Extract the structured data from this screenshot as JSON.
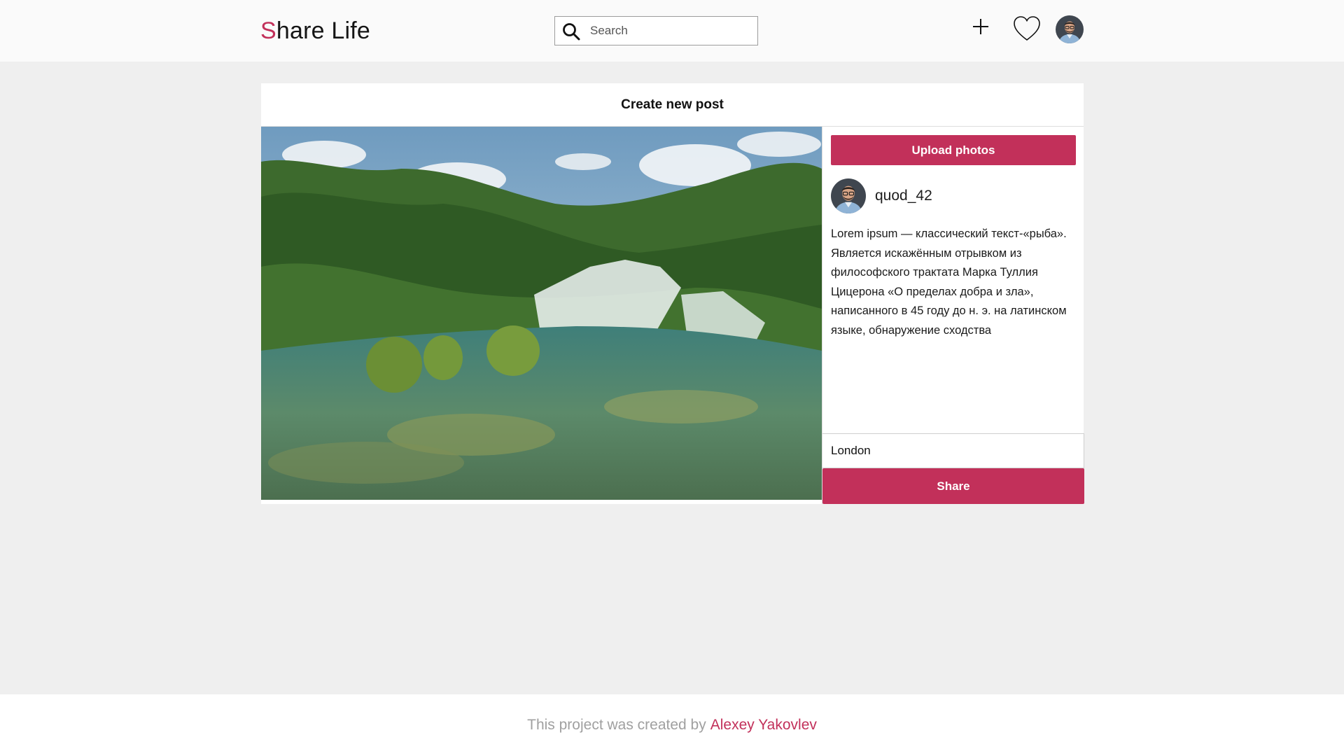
{
  "header": {
    "logo_first_letter": "S",
    "logo_rest": "hare Life",
    "search_placeholder": "Search",
    "icons": {
      "add": "plus-icon",
      "likes": "heart-icon",
      "profile": "avatar"
    }
  },
  "create_post": {
    "title": "Create new post",
    "photo_description": "waterfall landscape photo",
    "upload_label": "Upload photos",
    "username": "quod_42",
    "caption": "Lorem ipsum — классический текст-«рыба». Является искажённым отрывком из философского трактата Марка Туллия Цицерона «О пределах добра и зла», написанного в 45 году до н. э. на латинском языке, обнаружение сходства",
    "location_value": "London",
    "share_label": "Share"
  },
  "footer": {
    "prefix": "This project was created by",
    "author": "Alexey Yakovlev"
  },
  "colors": {
    "accent": "#c2305a",
    "background": "#efefef",
    "header_bg": "#fafafa"
  }
}
